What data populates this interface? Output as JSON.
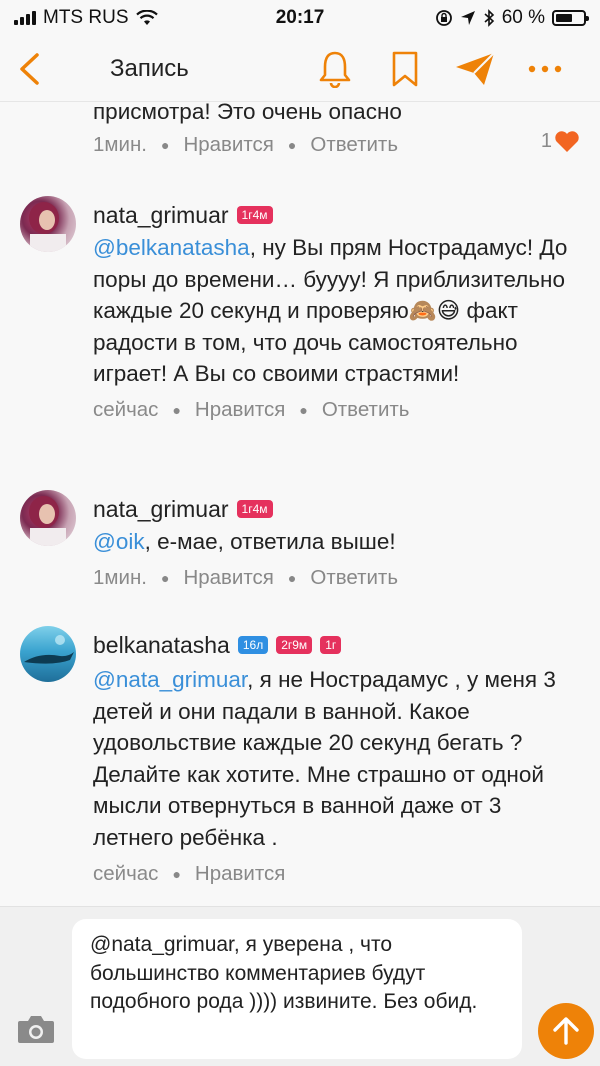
{
  "status_bar": {
    "carrier": "MTS RUS",
    "time": "20:17",
    "battery": "60 %",
    "battery_level": 0.6
  },
  "navbar": {
    "title": "Запись",
    "icons": [
      "back-icon",
      "bell-icon",
      "bookmark-icon",
      "send-icon",
      "more-icon"
    ]
  },
  "comments": [
    {
      "text": "присмотра!  Это очень опасно",
      "time": "1мин.",
      "like_label": "Нравится",
      "reply_label": "Ответить",
      "likes": "1"
    },
    {
      "author": "nata_grimuar",
      "badges": [
        "1г4м"
      ],
      "mention": "@belkanatasha",
      "text_before_emoji": ", ну Вы прям Нострадамус! До поры до времени… буууу! Я приблизительно каждые 20 секунд и проверяю",
      "emoji": "🙈😅",
      "text_after_emoji": " факт радости в том, что дочь самостоятельно играет! А Вы со своими страстями!",
      "time": "сейчас",
      "like_label": "Нравится",
      "reply_label": "Ответить"
    },
    {
      "author": "nata_grimuar",
      "badges": [
        "1г4м"
      ],
      "mention": "@oik",
      "text": ", е-мае, ответила выше!",
      "time": "1мин.",
      "like_label": "Нравится",
      "reply_label": "Ответить"
    },
    {
      "author": "belkanatasha",
      "badges": [
        "16л",
        "2г9м",
        "1г"
      ],
      "mention": "@nata_grimuar",
      "text": ", я не Нострадамус , у меня 3 детей и они падали в ванной. Какое удовольствие каждые 20 секунд бегать ? Делайте как хотите. Мне страшно от одной мысли отвернуться в ванной даже от 3 летнего ребёнка .",
      "time": "сейчас",
      "like_label": "Нравится"
    }
  ],
  "composer": {
    "value": "@nata_grimuar, я уверена , что большинство комментариев будут подобного рода )))) извините. Без обид."
  },
  "colors": {
    "accent": "#ee8208",
    "mention": "#3a8fd8",
    "badge_pink": "#e5315d",
    "badge_blue": "#2f8fe2",
    "like_heart": "#f26522"
  }
}
